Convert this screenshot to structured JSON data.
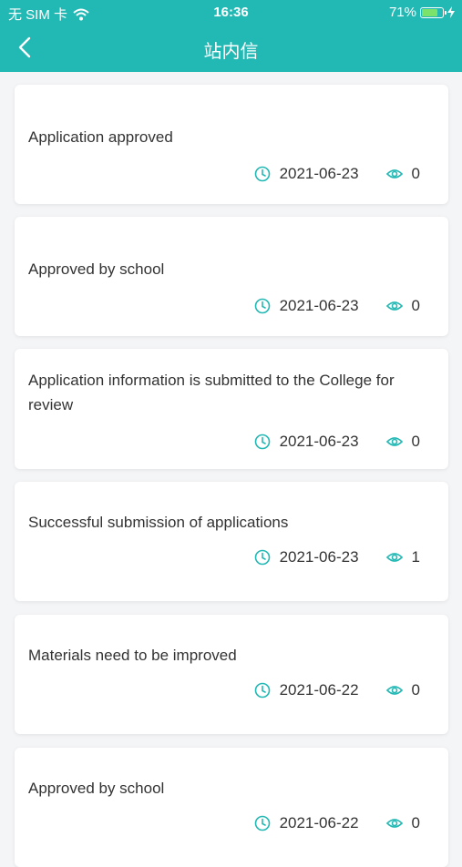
{
  "status_bar": {
    "carrier": "无 SIM 卡",
    "time": "16:36",
    "battery": "71%"
  },
  "nav": {
    "title": "站内信",
    "accent_color": "#22b8b4"
  },
  "messages": [
    {
      "title": "Application approved",
      "date": "2021-06-23",
      "views": "0"
    },
    {
      "title": "Approved by school",
      "date": "2021-06-23",
      "views": "0"
    },
    {
      "title": "Application information is submitted to the College for review",
      "date": "2021-06-23",
      "views": "0"
    },
    {
      "title": "Successful submission of applications",
      "date": "2021-06-23",
      "views": "1"
    },
    {
      "title": "Materials need to be improved",
      "date": "2021-06-22",
      "views": "0"
    },
    {
      "title": "Approved by school",
      "date": "2021-06-22",
      "views": "0"
    }
  ]
}
